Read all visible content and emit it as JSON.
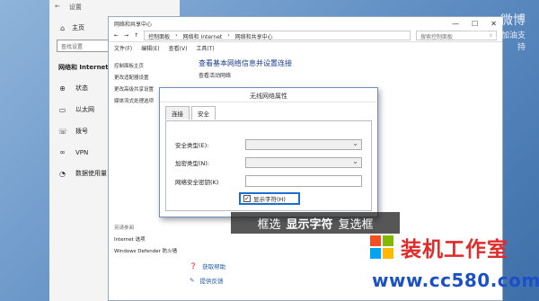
{
  "settings": {
    "title": "设置",
    "home": "主页",
    "search_placeholder": "查找设置",
    "section": "网络和 Internet",
    "nav": [
      {
        "label": "状态",
        "icon": "status-icon"
      },
      {
        "label": "以太网",
        "icon": "ethernet-icon"
      },
      {
        "label": "拨号",
        "icon": "dialup-icon"
      },
      {
        "label": "VPN",
        "icon": "vpn-icon"
      },
      {
        "label": "数据使用量",
        "icon": "data-usage-icon"
      }
    ]
  },
  "network_center": {
    "title": "网络和共享中心",
    "breadcrumb": [
      "控制面板",
      "网络和 Internet",
      "网络和共享中心"
    ],
    "search_placeholder": "搜索控制面板",
    "menu": [
      "文件(F)",
      "编辑(E)",
      "查看(V)",
      "工具(T)"
    ],
    "left_items": [
      "控制面板主页",
      "更改适配器设置",
      "更改高级共享设置",
      "媒体流式处理选项"
    ],
    "see_also_title": "另请参阅",
    "see_also": [
      "Internet 选项",
      "Windows Defender 防火墙"
    ],
    "main_title": "查看基本网络信息并设置连接",
    "main_subtitle": "查看活动网络",
    "help_links": [
      "获取帮助",
      "提供反馈"
    ]
  },
  "dialog": {
    "title": "无线网络属性",
    "tabs": [
      "连接",
      "安全"
    ],
    "fields": {
      "security_type": "安全类型(E):",
      "encryption_type": "加密类型(N):",
      "security_key": "网络安全密钥(K)"
    },
    "show_chars": "显示字符(H)",
    "show_chars_checked": true
  },
  "caption": {
    "pre": "框选",
    "bold": "显示字符",
    "post": "复选框"
  },
  "watermark": {
    "line1": "微博",
    "line2": "@电脑知识加油支持"
  },
  "logo": {
    "name": "装机工作室",
    "url": "www.cc580.com"
  }
}
